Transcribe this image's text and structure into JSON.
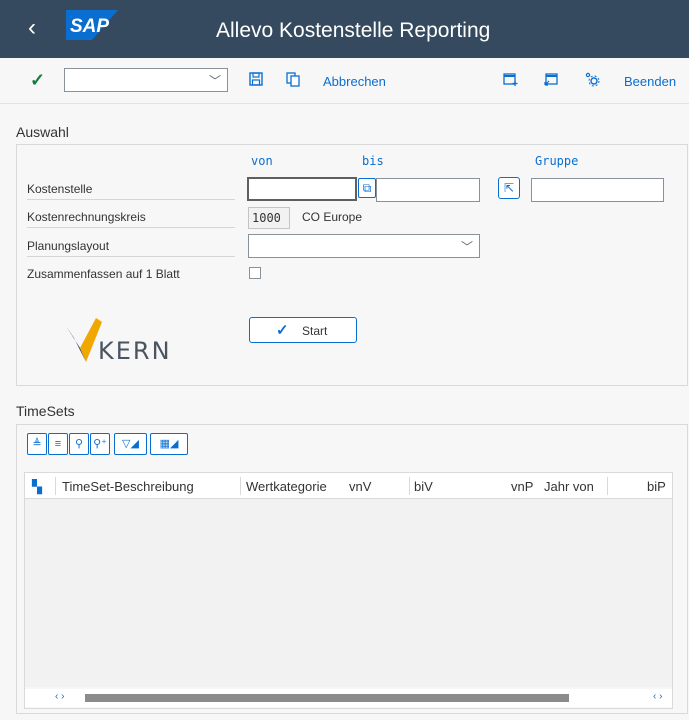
{
  "titlebar": {
    "back_glyph": "‹",
    "logo_text": "SAP",
    "title": "Allevo Kostenstelle Reporting",
    "bg": "#354a5f",
    "logo_color": "#0a6ed1"
  },
  "toolbar": {
    "command_value": "",
    "cancel_label": "Abbrechen",
    "exit_label": "Beenden"
  },
  "selection": {
    "section_title": "Auswahl",
    "col_from": "von",
    "col_to": "bis",
    "col_group": "Gruppe",
    "cost_center_label": "Kostenstelle",
    "cost_center_from": "",
    "cost_center_to": "",
    "cost_center_group": "",
    "controlling_area_label": "Kostenrechnungskreis",
    "controlling_area_value": "1000",
    "controlling_area_text": "CO Europe",
    "planning_layout_label": "Planungslayout",
    "planning_layout_value": "",
    "combine_label": "Zusammenfassen auf 1 Blatt",
    "combine_checked": false,
    "start_label": "Start",
    "logo_text": "KERN"
  },
  "timesets": {
    "section_title": "TimeSets",
    "columns": [
      "TimeSet-Beschreibung",
      "Wertkategorie",
      "vnV",
      "biV",
      "vnP",
      "Jahr von",
      "biP"
    ]
  }
}
